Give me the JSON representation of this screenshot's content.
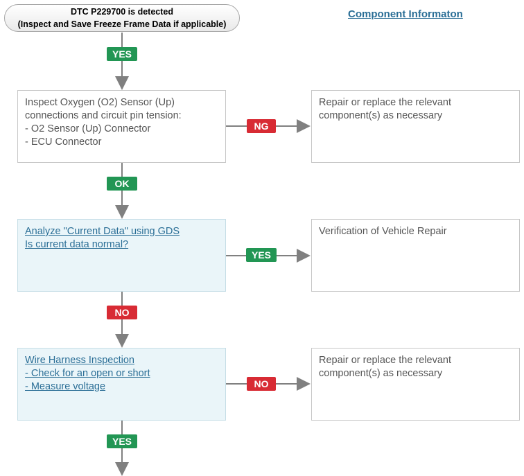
{
  "start": {
    "line1": "DTC P229700 is detected",
    "line2": "(Inspect and Save Freeze Frame Data if applicable)"
  },
  "component_link": "Component Informaton",
  "steps": [
    {
      "lines": [
        "Inspect Oxygen (O2) Sensor (Up)",
        "connections and circuit pin tension:",
        "- O2 Sensor (Up) Connector",
        "- ECU Connector"
      ]
    },
    {
      "lines": [
        "Analyze \"Current Data\" using GDS",
        "Is current data normal?"
      ]
    },
    {
      "lines": [
        "Wire Harness Inspection",
        "- Check for an open or short",
        "- Measure voltage"
      ]
    }
  ],
  "results": [
    {
      "lines": [
        "Repair or replace the relevant",
        "component(s) as necessary"
      ]
    },
    {
      "lines": [
        "Verification of Vehicle Repair"
      ]
    },
    {
      "lines": [
        "Repair or replace the relevant",
        "component(s) as necessary"
      ]
    }
  ],
  "badges": {
    "yes_1": "YES",
    "ng_1": "NG",
    "ok_1": "OK",
    "yes_2": "YES",
    "no_1": "NO",
    "no_2": "NO",
    "yes_3": "YES"
  },
  "colors": {
    "yes_ok": "#229654",
    "ng_no": "#d82b34",
    "link": "#2a6e96",
    "connector": "#808080",
    "highlight_box": "#eaf5f9"
  }
}
